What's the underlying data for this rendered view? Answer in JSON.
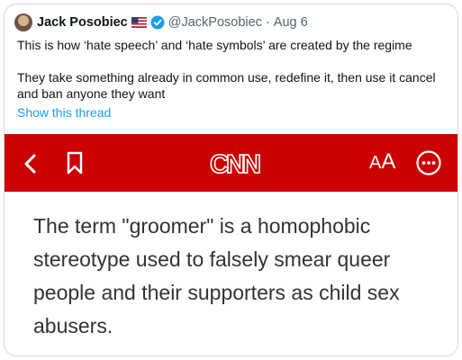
{
  "tweet": {
    "author_name": "Jack Posobiec",
    "handle": "@JackPosobiec",
    "separator": "·",
    "date": "Aug 6",
    "paragraphs": [
      "This is how ‘hate speech’ and ‘hate symbols’ are created by the regime",
      "They take something already in common use, redefine it, then use it cancel and ban anyone they want"
    ],
    "show_thread_label": "Show this thread"
  },
  "icons": {
    "avatar": "avatar",
    "flag": "us-flag-icon",
    "verified": "verified-badge-icon"
  },
  "cnn": {
    "brand_color": "#cc0000",
    "logo_text": "CNN",
    "text_size_label_small": "A",
    "text_size_label_large": "A",
    "icons": [
      "back-chevron-icon",
      "bookmark-icon",
      "more-icon"
    ],
    "article_text": "The term \"groomer\" is a homophobic stereotype used to falsely smear queer people and their supporters as child sex abusers."
  },
  "colors": {
    "link": "#1d9bf0",
    "text": "#0f1419",
    "muted": "#536471"
  }
}
